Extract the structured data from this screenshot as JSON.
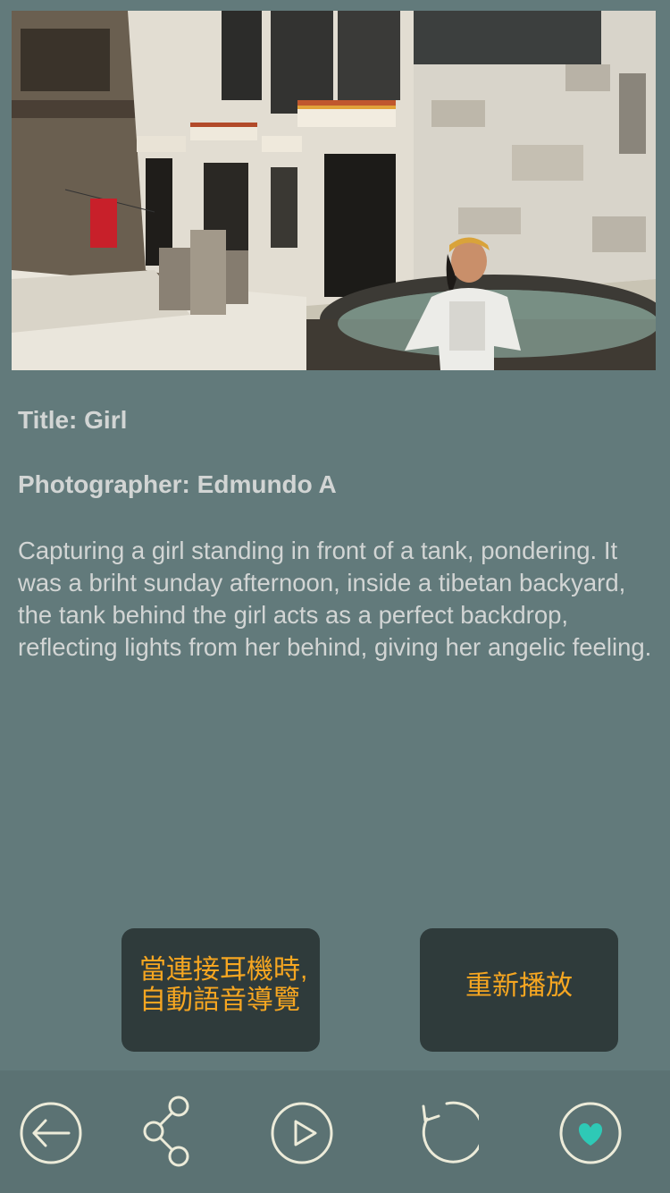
{
  "photo": {
    "alt": "Girl standing in front of a tank in a Tibetan backyard"
  },
  "info": {
    "title": "Title: Girl",
    "photographer": "Photographer: Edmundo A",
    "description": "Capturing a girl standing in front of a tank, pondering. It was a briht sunday afternoon, inside a tibetan backyard, the tank behind the girl acts as a perfect backdrop, reflecting lights from her behind, giving her angelic feeling."
  },
  "tooltips": {
    "audio_guide": "當連接耳機時,\n自動語音導覽",
    "replay": "重新播放"
  },
  "nav": {
    "items": [
      {
        "icon": "back-arrow-icon"
      },
      {
        "icon": "share-icon"
      },
      {
        "icon": "play-icon"
      },
      {
        "icon": "replay-icon"
      },
      {
        "icon": "heart-icon"
      }
    ]
  },
  "colors": {
    "background": "#627a7b",
    "bottom_bar": "#5b7273",
    "tooltip_bg": "#2f3b3b",
    "tooltip_text": "#f6a621",
    "icon_stroke": "#ecebd9",
    "heart_fill": "#2ec9b6",
    "body_text": "#d2d5d4"
  }
}
